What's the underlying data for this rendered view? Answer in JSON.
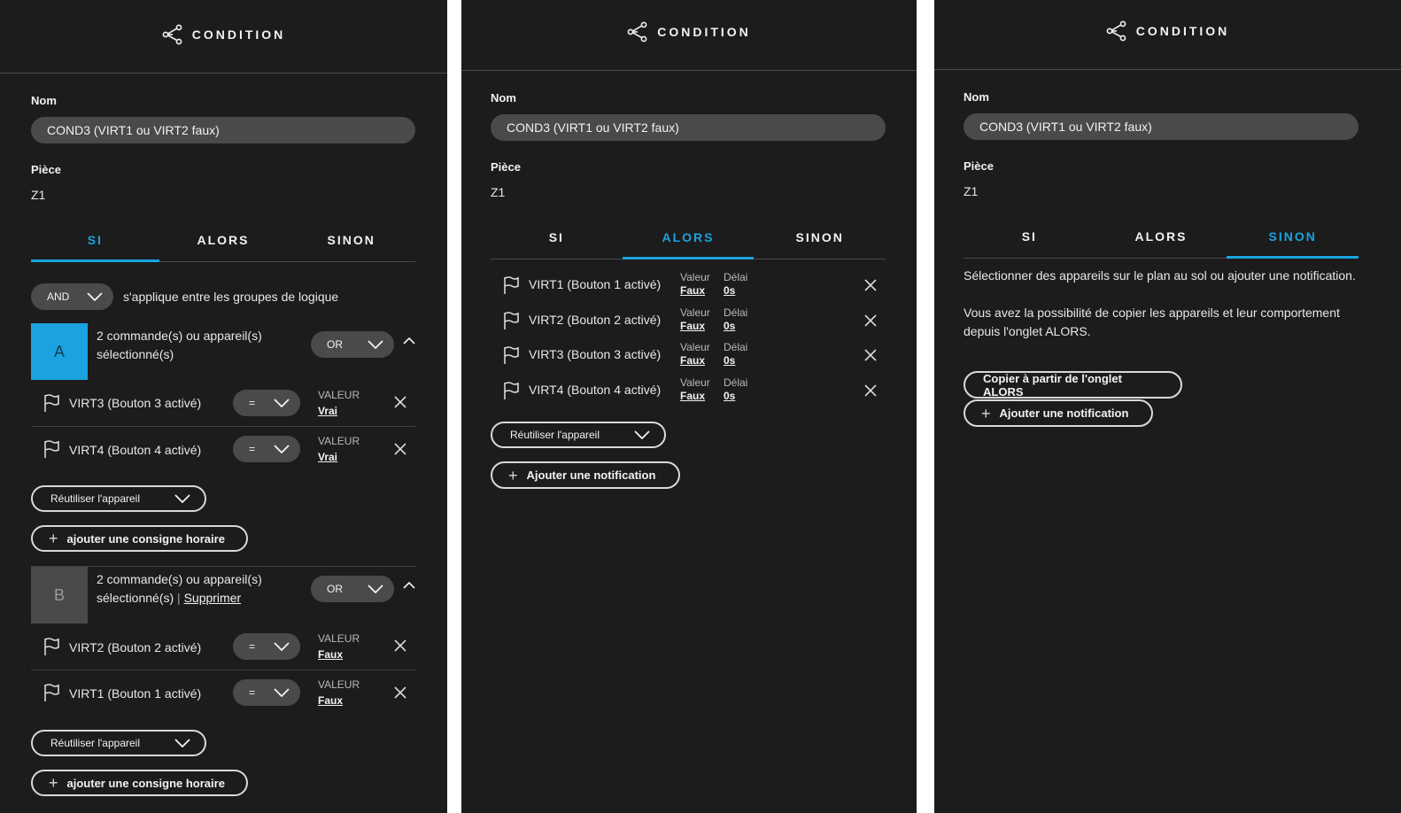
{
  "header": {
    "title": "CONDITION",
    "icon": "share-nodes-icon"
  },
  "form": {
    "name_label": "Nom",
    "name_value": "COND3 (VIRT1 ou VIRT2 faux)",
    "room_label": "Pièce",
    "room_value": "Z1"
  },
  "tabs": [
    "SI",
    "ALORS",
    "SINON"
  ],
  "colors": {
    "accent": "#1aa3e0",
    "panel": "#1c1c1d",
    "pill": "#4a4a4c",
    "group_b": "#4a4a4c"
  },
  "si": {
    "logic_operator": "AND",
    "logic_text": "s'applique entre les groupes de logique",
    "groups": [
      {
        "letter": "A",
        "line1": "2 commande(s) ou appareil(s)",
        "line2": "sélectionné(s)",
        "delete_label": "",
        "operator": "OR",
        "items": [
          {
            "name": "VIRT3 (Bouton 3 activé)",
            "op": "=",
            "value_label": "VALEUR",
            "value": "Vrai"
          },
          {
            "name": "VIRT4 (Bouton 4 activé)",
            "op": "=",
            "value_label": "VALEUR",
            "value": "Vrai"
          }
        ],
        "reuse_label": "Réutiliser l'appareil",
        "add_label": "ajouter une consigne horaire"
      },
      {
        "letter": "B",
        "line1": "2 commande(s) ou appareil(s)",
        "line2": "sélectionné(s)",
        "separator": "|",
        "delete_label": "Supprimer",
        "operator": "OR",
        "items": [
          {
            "name": "VIRT2 (Bouton 2 activé)",
            "op": "=",
            "value_label": "VALEUR",
            "value": "Faux"
          },
          {
            "name": "VIRT1 (Bouton 1 activé)",
            "op": "=",
            "value_label": "VALEUR",
            "value": "Faux"
          }
        ],
        "reuse_label": "Réutiliser l'appareil",
        "add_label": "ajouter une consigne horaire"
      }
    ]
  },
  "alors": {
    "items": [
      {
        "name": "VIRT1 (Bouton 1 activé)",
        "value_label": "Valeur",
        "value": "Faux",
        "delay_label": "Délai",
        "delay": "0s"
      },
      {
        "name": "VIRT2 (Bouton 2 activé)",
        "value_label": "Valeur",
        "value": "Faux",
        "delay_label": "Délai",
        "delay": "0s"
      },
      {
        "name": "VIRT3 (Bouton 3 activé)",
        "value_label": "Valeur",
        "value": "Faux",
        "delay_label": "Délai",
        "delay": "0s"
      },
      {
        "name": "VIRT4 (Bouton 4 activé)",
        "value_label": "Valeur",
        "value": "Faux",
        "delay_label": "Délai",
        "delay": "0s"
      }
    ],
    "reuse_label": "Réutiliser l'appareil",
    "add_notification_label": "Ajouter une notification"
  },
  "sinon": {
    "para1": "Sélectionner des appareils sur le plan au sol ou ajouter une notification.",
    "para2": "Vous avez la possibilité de copier les appareils et leur comportement depuis l'onglet ALORS.",
    "copy_label": "Copier à partir de l'onglet ALORS",
    "add_notification_label": "Ajouter une notification"
  }
}
